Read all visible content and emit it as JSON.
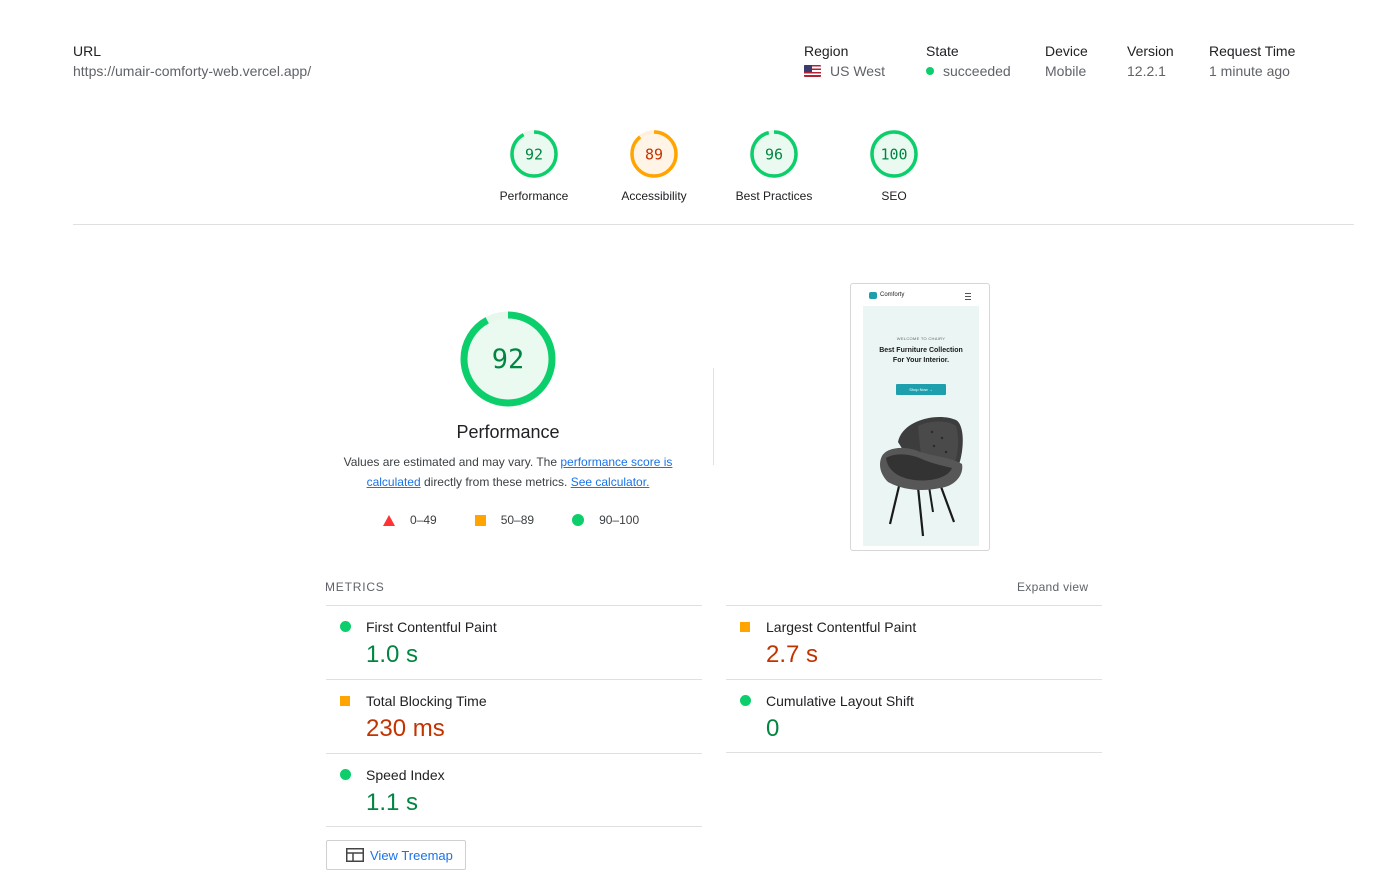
{
  "header": {
    "url_label": "URL",
    "url_value": "https://umair-comforty-web.vercel.app/",
    "region_label": "Region",
    "region_value": "US West",
    "state_label": "State",
    "state_value": "succeeded",
    "device_label": "Device",
    "device_value": "Mobile",
    "version_label": "Version",
    "version_value": "12.2.1",
    "request_time_label": "Request Time",
    "request_time_value": "1 minute ago"
  },
  "gauges": [
    {
      "score": "92",
      "label": "Performance",
      "status": "good"
    },
    {
      "score": "89",
      "label": "Accessibility",
      "status": "average"
    },
    {
      "score": "96",
      "label": "Best Practices",
      "status": "good"
    },
    {
      "score": "100",
      "label": "SEO",
      "status": "good"
    }
  ],
  "performance": {
    "score": "92",
    "title": "Performance",
    "desc_prefix": "Values are estimated and may vary. The ",
    "desc_link1": "performance score is calculated",
    "desc_middle": " directly from these metrics. ",
    "desc_link2": "See calculator.",
    "legend": {
      "fail": "0–49",
      "average": "50–89",
      "pass": "90–100"
    }
  },
  "screenshot": {
    "brand": "Comforty",
    "welcome": "WELCOME TO CHAIRY",
    "headline": "Best Furniture Collection For Your Interior.",
    "button": "Shop Now →"
  },
  "metrics": {
    "header": "METRICS",
    "expand_label": "Expand view",
    "items": [
      {
        "name": "First Contentful Paint",
        "value": "1.0 s",
        "status": "good"
      },
      {
        "name": "Largest Contentful Paint",
        "value": "2.7 s",
        "status": "average"
      },
      {
        "name": "Total Blocking Time",
        "value": "230 ms",
        "status": "average"
      },
      {
        "name": "Cumulative Layout Shift",
        "value": "0",
        "status": "good"
      },
      {
        "name": "Speed Index",
        "value": "1.1 s",
        "status": "good"
      }
    ]
  },
  "treemap": {
    "label": "View Treemap"
  },
  "colors": {
    "good": "#0cce6b",
    "average": "#ffa400",
    "fail": "#ff3333",
    "link": "#1a73e8"
  }
}
